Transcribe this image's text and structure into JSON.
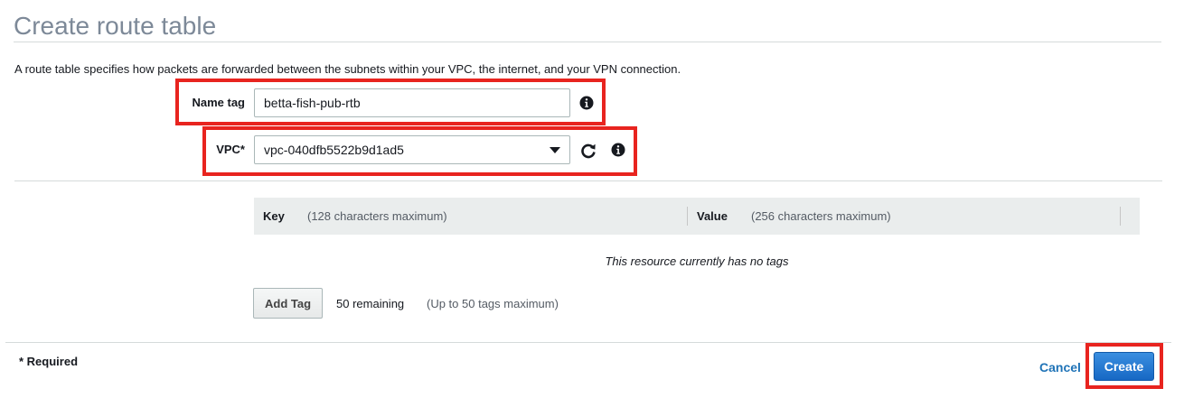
{
  "page": {
    "title": "Create route table",
    "description": "A route table specifies how packets are forwarded between the subnets within your VPC, the internet, and your VPN connection."
  },
  "form": {
    "name_tag": {
      "label": "Name tag",
      "value": "betta-fish-pub-rtb",
      "info_icon": "info-icon"
    },
    "vpc": {
      "label": "VPC*",
      "selected": "vpc-040dfb5522b9d1ad5",
      "refresh_icon": "refresh-icon",
      "info_icon": "info-icon"
    }
  },
  "tags": {
    "key_label": "Key",
    "key_hint": "(128 characters maximum)",
    "value_label": "Value",
    "value_hint": "(256 characters maximum)",
    "empty_message": "This resource currently has no tags",
    "add_tag_label": "Add Tag",
    "remaining": "50 remaining",
    "limit_hint": "(Up to 50 tags maximum)"
  },
  "footer": {
    "required_note": "* Required",
    "cancel_label": "Cancel",
    "create_label": "Create"
  },
  "colors": {
    "highlight": "#e8241f",
    "primary_button": "#1768c4",
    "link": "#1f73b7",
    "title": "#7d8998"
  }
}
